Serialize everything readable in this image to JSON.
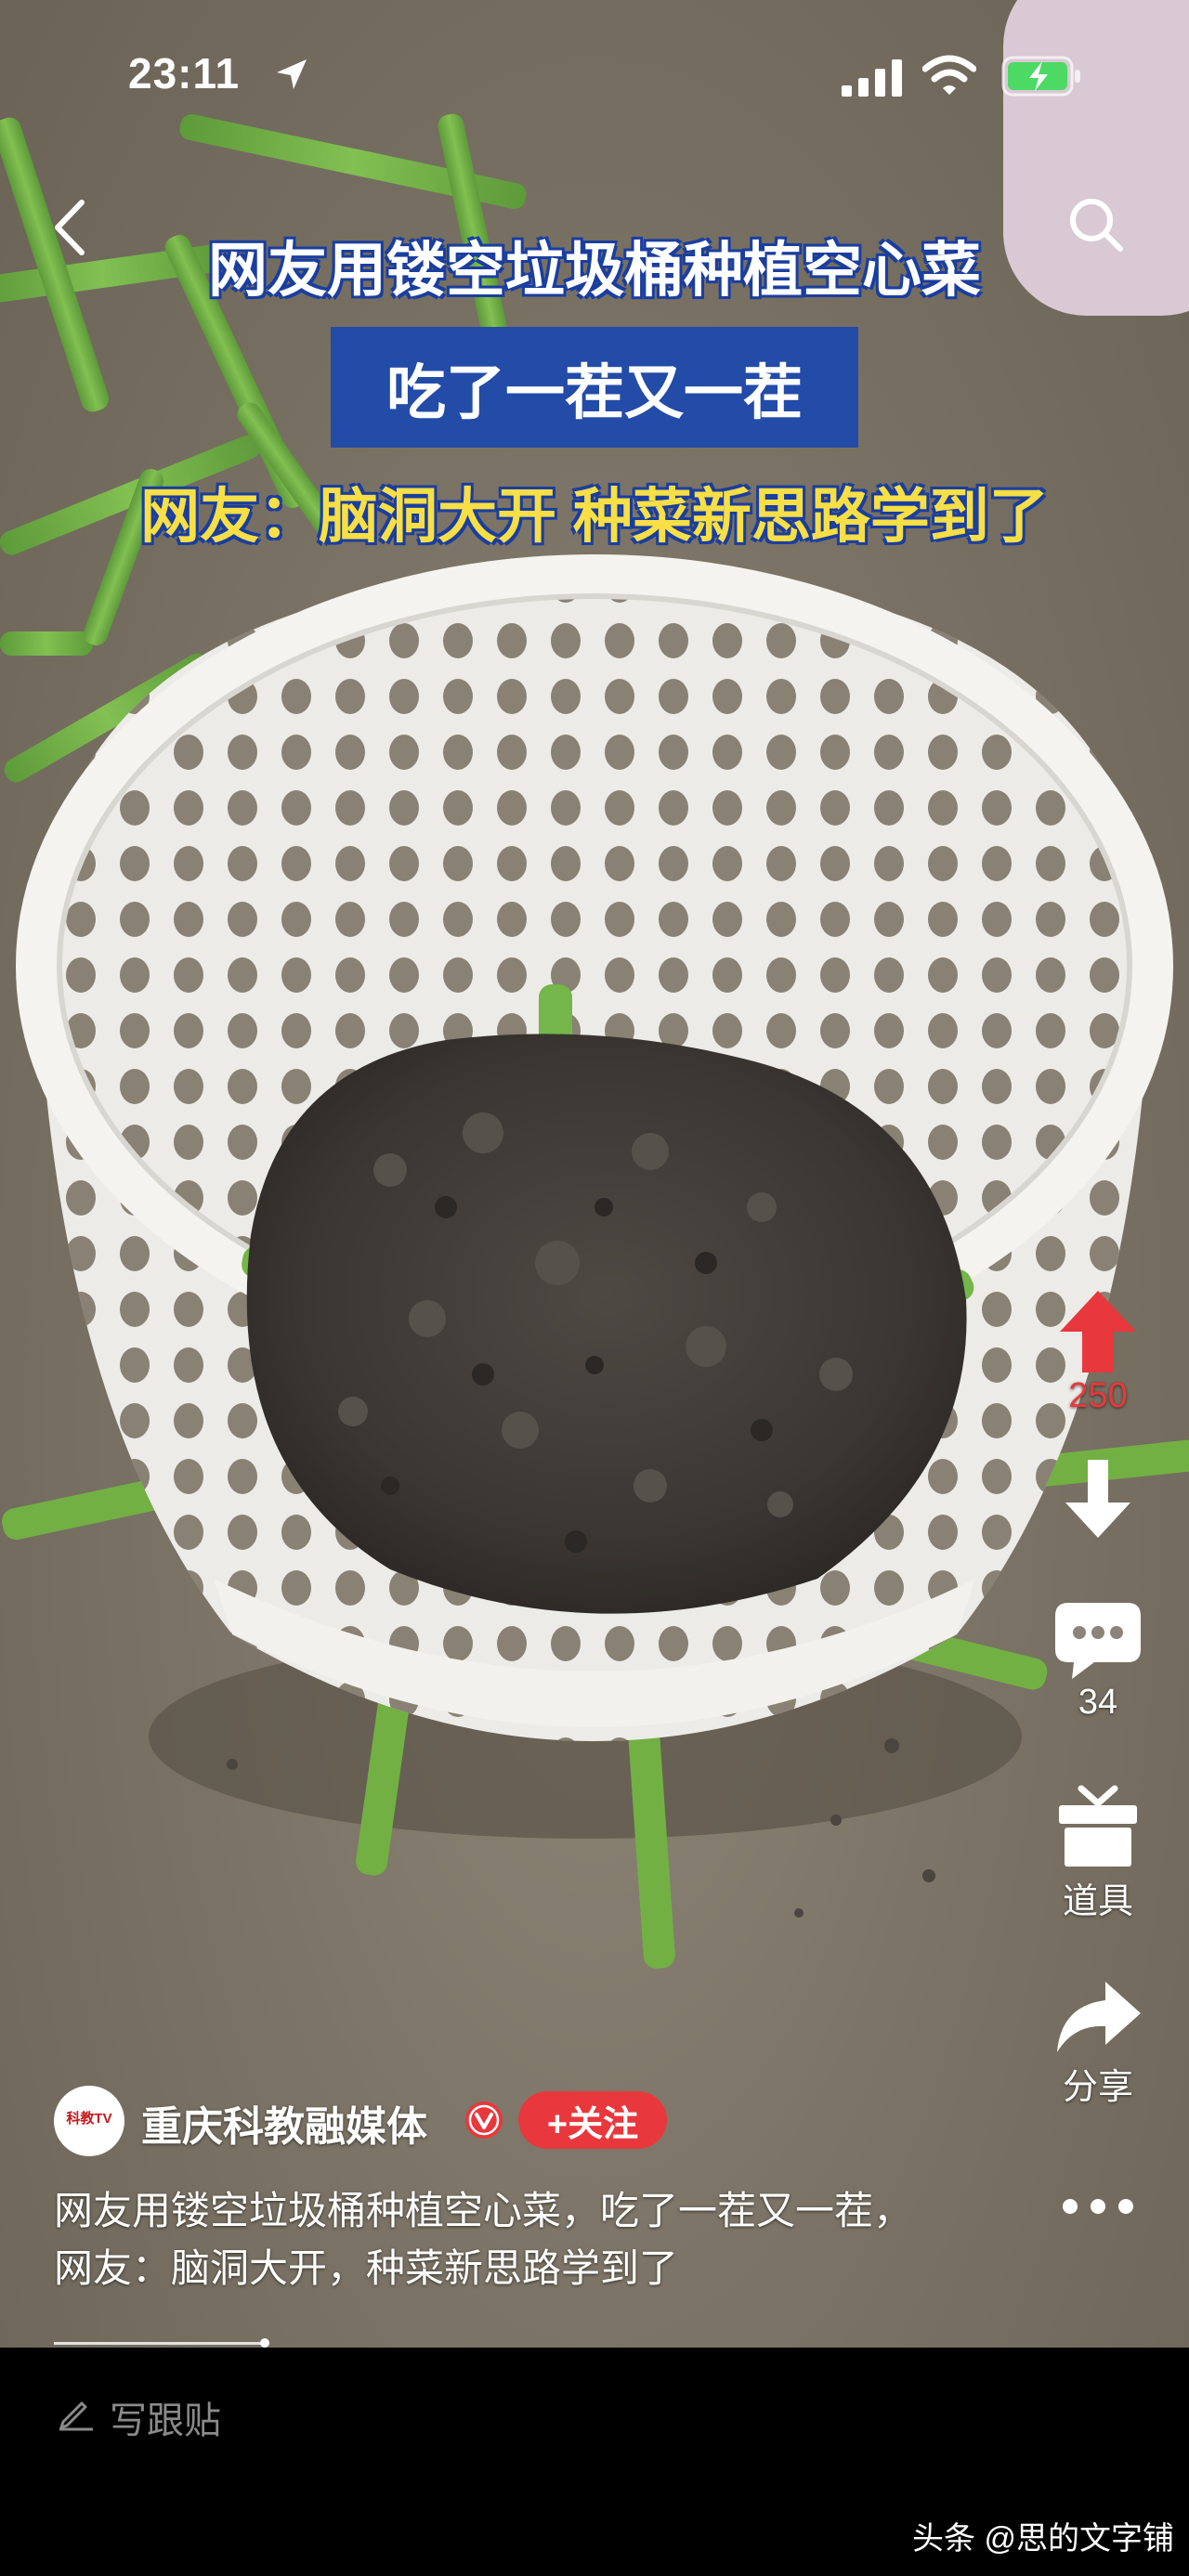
{
  "status_bar": {
    "time": "23:11",
    "icons": [
      "location-arrow-icon",
      "cellular-signal-icon",
      "wifi-icon",
      "battery-charging-icon"
    ],
    "battery_color": "#4cd964"
  },
  "nav": {
    "back_icon": "chevron-left-icon",
    "search_icon": "search-icon"
  },
  "video": {
    "caption_line1": "网友用镂空垃圾桶种植空心菜",
    "caption_line2": "吃了一茬又一茬",
    "caption_line3": "网友：脑洞大开 种菜新思路学到了",
    "caption_colors": {
      "line1": "#ffffff",
      "line2_bg": "#234ba8",
      "line3": "#f7df45"
    }
  },
  "actions": {
    "upvote": {
      "icon": "arrow-up-icon",
      "count": "250",
      "color": "#e8383d"
    },
    "downvote": {
      "icon": "arrow-down-icon"
    },
    "comments": {
      "icon": "comment-bubble-icon",
      "count": "34"
    },
    "props": {
      "icon": "gift-box-icon",
      "label": "道具"
    },
    "share": {
      "icon": "share-arrow-icon",
      "label": "分享"
    },
    "more": {
      "icon": "more-dots-icon"
    }
  },
  "author": {
    "avatar_text": "科教TV",
    "name": "重庆科教融媒体",
    "verified_icon": "verified-badge-icon",
    "follow_label": "+关注"
  },
  "description": {
    "line1": "网友用镂空垃圾桶种植空心菜，吃了一茬又一茬，",
    "line2": "网友：脑洞大开，种菜新思路学到了"
  },
  "bottom": {
    "write_label": "写跟贴",
    "watermark": "头条 @思的文字铺"
  }
}
